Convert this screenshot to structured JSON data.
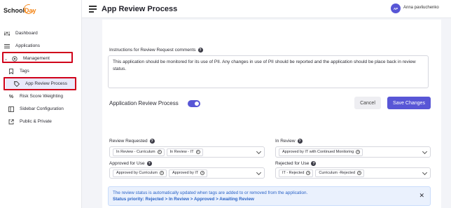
{
  "brand": {
    "logo_school": "School",
    "logo_day": "Day",
    "accent": "#5856d6",
    "logo_orange": "#f58a1f"
  },
  "sidebar": {
    "items": [
      {
        "label": "Dashboard",
        "icon": "sliders-icon"
      },
      {
        "label": "Applications",
        "icon": "list-icon"
      },
      {
        "label": "Management",
        "icon": "gear-icon",
        "expanded": true
      },
      {
        "label": "Tags",
        "icon": "bookmark-icon"
      },
      {
        "label": "App Review Process",
        "icon": "tag-icon",
        "active": true
      },
      {
        "label": "Risk Score Weighting",
        "icon": "percent-icon"
      },
      {
        "label": "Sidebar Configuration",
        "icon": "sidebar-icon"
      },
      {
        "label": "Public & Private",
        "icon": "external-link-icon"
      }
    ]
  },
  "header": {
    "title": "App Review Process",
    "user_initials": "AP",
    "user_name": "Anna pavliuchenko"
  },
  "instructions": {
    "label": "Instructions for Review Request comments",
    "text": "This application should be monitored for its use of PII.  Any changes in use of PII should be reported and the application should be place back in review status."
  },
  "process": {
    "label": "Application Review Process",
    "enabled": true,
    "cancel_label": "Cancel",
    "save_label": "Save Changes"
  },
  "fields": {
    "review_requested": {
      "label": "Review Requested",
      "chips": [
        "In Review - Curriculum",
        "In Review - IT"
      ]
    },
    "in_review": {
      "label": "In Review",
      "chips": [
        "Approved by IT with Continued Monitoring"
      ]
    },
    "approved_for_use": {
      "label": "Approved for Use",
      "chips": [
        "Approved by Curriculum",
        "Approved by IT"
      ]
    },
    "rejected_for_use": {
      "label": "Rejected for Use",
      "chips": [
        "IT - Rejected",
        "Curriculum -Rejected"
      ]
    }
  },
  "info": {
    "line1": "The review status is automatically updated when tags are added to or removed from the application.",
    "line2": "Status priority: Rejected > In Review > Approved > Awaiting Review"
  }
}
